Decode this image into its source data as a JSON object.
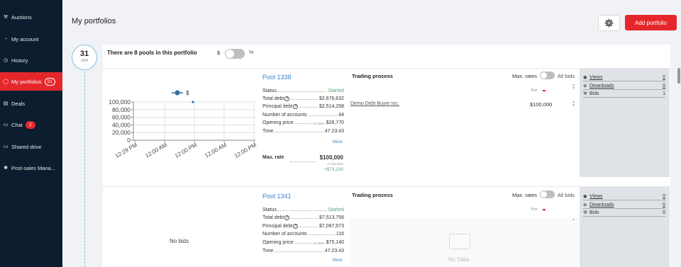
{
  "sidebar": {
    "items": [
      {
        "label": "Auctions",
        "icon": "hammer-icon",
        "glyph": "⚒"
      },
      {
        "label": "My account",
        "icon": "user-icon",
        "glyph": "◔"
      },
      {
        "label": "History",
        "icon": "history-icon",
        "glyph": "◷"
      },
      {
        "label": "My portfolios",
        "icon": "portfolio-icon",
        "glyph": "◯",
        "badge": "21",
        "active": true
      },
      {
        "label": "Deals",
        "icon": "deals-icon",
        "glyph": "▤"
      },
      {
        "label": "Chat",
        "icon": "chat-icon",
        "glyph": "▭",
        "badge": "2"
      },
      {
        "label": "Shared drive",
        "icon": "drive-icon",
        "glyph": "▭"
      },
      {
        "label": "Post-sales Mana...",
        "icon": "post-sales-icon",
        "glyph": "✺"
      }
    ]
  },
  "header": {
    "title": "My portfolios",
    "settings_icon": "gear-icon",
    "add_label": "Add portfolio"
  },
  "colors": {
    "accent": "#e5272b",
    "sidebar": "#0b1d2e",
    "link": "#3a86c8",
    "green": "#52a86e"
  },
  "portfolio": {
    "date_day": "31",
    "date_month": "JAN",
    "pools_text": "There are 8 pools in this portfolio",
    "currency_label": "$",
    "percent_label": "%"
  },
  "pools": [
    {
      "name": "Pool 1338",
      "status_label": "Status",
      "status_value": "Started",
      "total_debt_label": "Total debt",
      "total_debt": "$2,676,632",
      "principal_debt_label": "Principal debt",
      "principal_debt": "$2,514,258",
      "accounts_label": "Number of accounts",
      "accounts": "44",
      "opening_price_label": "Opening price",
      "opening_price_pct": "1/1.06%",
      "opening_price": "$26,770",
      "time_label": "Time",
      "time": "47:23:43",
      "more": "More",
      "max_rate_label": "Max. rate",
      "max_rate": "$100,000",
      "max_rate_sub": "3.74/3.98%",
      "max_rate_change": "+$73,230",
      "trading_title": "Trading process",
      "max_rates_label": "Max. rates",
      "all_bids_label": "All bids",
      "bid_header": "Bid",
      "bids": [
        {
          "buyer": "Demo Debt Buyer Inc.",
          "amount": "$100,000"
        }
      ],
      "stats": [
        {
          "label": "Views",
          "count": "0",
          "icon": "eye-icon",
          "glyph": "◉"
        },
        {
          "label": "Downloads",
          "count": "0",
          "icon": "download-icon",
          "glyph": "⊕"
        },
        {
          "label": "Bids",
          "count": "1",
          "icon": "gavel-icon",
          "glyph": "⚒"
        }
      ]
    },
    {
      "name": "Pool 1341",
      "no_bids": "No bids",
      "status_label": "Status",
      "status_value": "Started",
      "total_debt_label": "Total debt",
      "total_debt": "$7,513,756",
      "principal_debt_label": "Principal debt",
      "principal_debt": "$7,087,973",
      "accounts_label": "Number of accounts",
      "accounts": "116",
      "opening_price_label": "Opening price",
      "opening_price_pct": "1/1.06%",
      "opening_price": "$75,140",
      "time_label": "Time",
      "time": "47:23:43",
      "more": "More",
      "trading_title": "Trading process",
      "max_rates_label": "Max. rates",
      "all_bids_label": "All bids",
      "bid_header": "Bid",
      "no_data": "No Data",
      "stats": [
        {
          "label": "Views",
          "count": "0",
          "icon": "eye-icon",
          "glyph": "◉"
        },
        {
          "label": "Downloads",
          "count": "0",
          "icon": "download-icon",
          "glyph": "⊕"
        },
        {
          "label": "Bids",
          "count": "0",
          "icon": "gavel-icon",
          "glyph": "⚒"
        }
      ]
    }
  ],
  "chart_data": {
    "type": "line",
    "series": [
      {
        "name": "$",
        "x": [
          "12:00 PM"
        ],
        "values": [
          100000
        ]
      }
    ],
    "x_ticks": [
      "12:29 PM",
      "12:00 AM",
      "12:00 PM",
      "12:00 AM",
      "12:00 PM"
    ],
    "y_ticks": [
      "0",
      "20,000",
      "40,000",
      "60,000",
      "80,000",
      "100,000"
    ],
    "ylim": [
      0,
      100000
    ],
    "grid": true,
    "legend": "top"
  }
}
